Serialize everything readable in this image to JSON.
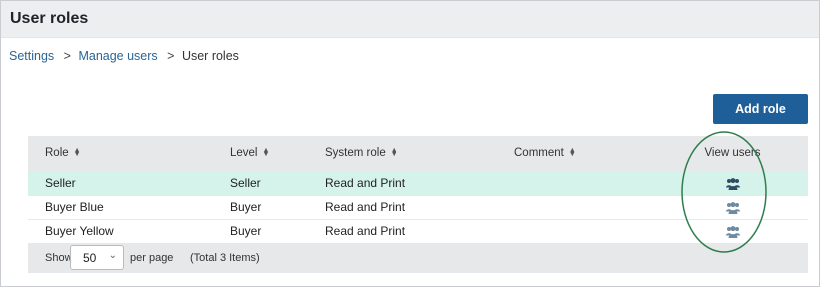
{
  "header": {
    "title": "User roles"
  },
  "breadcrumb": {
    "items": [
      "Settings",
      "Manage users",
      "User roles"
    ],
    "separator": ">"
  },
  "toolbar": {
    "add_label": "Add role"
  },
  "table": {
    "columns": [
      "Role",
      "Level",
      "System role",
      "Comment",
      "View users"
    ],
    "rows": [
      {
        "role": "Seller",
        "level": "Seller",
        "system_role": "Read and Print",
        "comment": "",
        "view_icon": "users-icon"
      },
      {
        "role": "Buyer Blue",
        "level": "Buyer",
        "system_role": "Read and Print",
        "comment": "",
        "view_icon": "users-icon"
      },
      {
        "role": "Buyer Yellow",
        "level": "Buyer",
        "system_role": "Read and Print",
        "comment": "",
        "view_icon": "users-icon"
      }
    ],
    "selected_row": 0
  },
  "pagination": {
    "show_label": "Show",
    "page_size": "50",
    "per_page_label": "per page",
    "total_label": "(Total 3 Items)"
  },
  "colors": {
    "accent": "#1f5f99",
    "selected_row": "#d5f3eb",
    "highlight": "#2e7d4f"
  }
}
